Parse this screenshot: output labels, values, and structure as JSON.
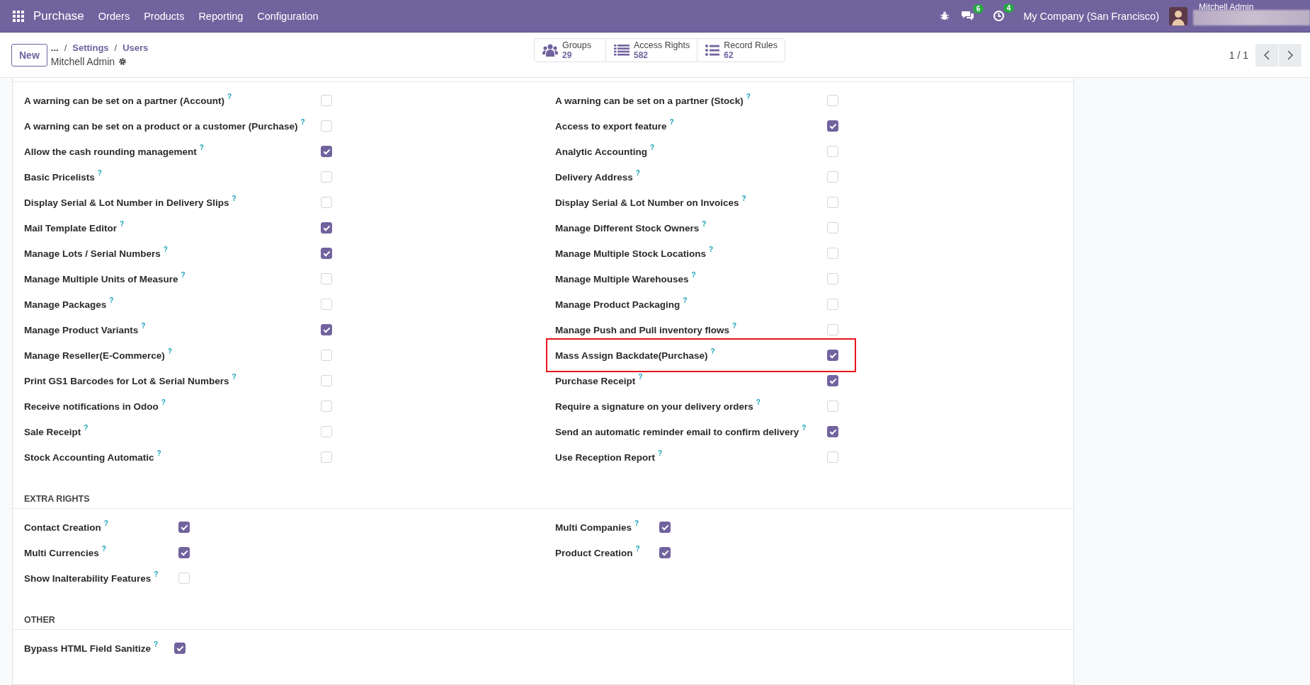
{
  "navbar": {
    "app": "Purchase",
    "menus": [
      "Orders",
      "Products",
      "Reporting",
      "Configuration"
    ],
    "messages_count": "6",
    "activities_count": "4",
    "company": "My Company (San Francisco)",
    "user": "Mitchell Admin"
  },
  "control_panel": {
    "new_button": "New",
    "breadcrumb": [
      {
        "kind": "link",
        "text": "..."
      },
      {
        "kind": "separator",
        "text": "/"
      },
      {
        "kind": "link",
        "text": "Settings"
      },
      {
        "kind": "separator",
        "text": "/"
      },
      {
        "kind": "link",
        "text": "Users"
      }
    ],
    "record": "Mitchell Admin",
    "stat_buttons": [
      {
        "kind": "groups",
        "label": "Groups",
        "value": "29"
      },
      {
        "kind": "list",
        "label": "Access Rights",
        "value": "582"
      },
      {
        "kind": "bullets",
        "label": "Record Rules",
        "value": "62"
      }
    ],
    "pager": "1 / 1"
  },
  "sections": [
    {
      "columns": [
        [
          {
            "label": "A warning can be set on a partner (Account)",
            "help": "?",
            "checked": false,
            "highlighted": false
          },
          {
            "label": "A warning can be set on a product or a customer (Purchase)",
            "help": "?",
            "checked": false,
            "highlighted": false
          },
          {
            "label": "Allow the cash rounding management",
            "help": "?",
            "checked": true,
            "highlighted": false
          },
          {
            "label": "Basic Pricelists",
            "help": "?",
            "checked": false,
            "highlighted": false
          },
          {
            "label": "Display Serial & Lot Number in Delivery Slips",
            "help": "?",
            "checked": false,
            "highlighted": false
          },
          {
            "label": "Mail Template Editor",
            "help": "?",
            "checked": true,
            "highlighted": false
          },
          {
            "label": "Manage Lots / Serial Numbers",
            "help": "?",
            "checked": true,
            "highlighted": false
          },
          {
            "label": "Manage Multiple Units of Measure",
            "help": "?",
            "checked": false,
            "highlighted": false
          },
          {
            "label": "Manage Packages",
            "help": "?",
            "checked": false,
            "highlighted": false
          },
          {
            "label": "Manage Product Variants",
            "help": "?",
            "checked": true,
            "highlighted": false
          },
          {
            "label": "Manage Reseller(E-Commerce)",
            "help": "?",
            "checked": false,
            "highlighted": false
          },
          {
            "label": "Print GS1 Barcodes for Lot & Serial Numbers",
            "help": "?",
            "checked": false,
            "highlighted": false
          },
          {
            "label": "Receive notifications in Odoo",
            "help": "?",
            "checked": false,
            "highlighted": false
          },
          {
            "label": "Sale Receipt",
            "help": "?",
            "checked": false,
            "highlighted": false
          },
          {
            "label": "Stock Accounting Automatic",
            "help": "?",
            "checked": false,
            "highlighted": false
          }
        ],
        [
          {
            "label": "A warning can be set on a partner (Stock)",
            "help": "?",
            "checked": false,
            "highlighted": false
          },
          {
            "label": "Access to export feature",
            "help": "?",
            "checked": true,
            "highlighted": false
          },
          {
            "label": "Analytic Accounting",
            "help": "?",
            "checked": false,
            "highlighted": false
          },
          {
            "label": "Delivery Address",
            "help": "?",
            "checked": false,
            "highlighted": false
          },
          {
            "label": "Display Serial & Lot Number on Invoices",
            "help": "?",
            "checked": false,
            "highlighted": false
          },
          {
            "label": "Manage Different Stock Owners",
            "help": "?",
            "checked": false,
            "highlighted": false
          },
          {
            "label": "Manage Multiple Stock Locations",
            "help": "?",
            "checked": false,
            "highlighted": false
          },
          {
            "label": "Manage Multiple Warehouses",
            "help": "?",
            "checked": false,
            "highlighted": false
          },
          {
            "label": "Manage Product Packaging",
            "help": "?",
            "checked": false,
            "highlighted": false
          },
          {
            "label": "Manage Push and Pull inventory flows",
            "help": "?",
            "checked": false,
            "highlighted": false
          },
          {
            "label": "Mass Assign Backdate(Purchase)",
            "help": "?",
            "checked": true,
            "highlighted": true
          },
          {
            "label": "Purchase Receipt",
            "help": "?",
            "checked": true,
            "highlighted": false
          },
          {
            "label": "Require a signature on your delivery orders",
            "help": "?",
            "checked": false,
            "highlighted": false
          },
          {
            "label": "Send an automatic reminder email to confirm delivery",
            "help": "?",
            "checked": true,
            "highlighted": false
          },
          {
            "label": "Use Reception Report",
            "help": "?",
            "checked": false,
            "highlighted": false
          }
        ]
      ]
    },
    {
      "title": "EXTRA RIGHTS",
      "columns": [
        [
          {
            "label": "Contact Creation",
            "help": "?",
            "checked": true,
            "highlighted": false
          },
          {
            "label": "Multi Currencies",
            "help": "?",
            "checked": true,
            "highlighted": false
          },
          {
            "label": "Show Inalterability Features",
            "help": "?",
            "checked": false,
            "highlighted": false
          }
        ],
        [
          {
            "label": "Multi Companies",
            "help": "?",
            "checked": true,
            "highlighted": false
          },
          {
            "label": "Product Creation",
            "help": "?",
            "checked": true,
            "highlighted": false
          }
        ]
      ]
    },
    {
      "title": "OTHER",
      "columns": [
        [
          {
            "label": "Bypass HTML Field Sanitize",
            "help": "?",
            "checked": true,
            "highlighted": false
          }
        ]
      ]
    }
  ]
}
